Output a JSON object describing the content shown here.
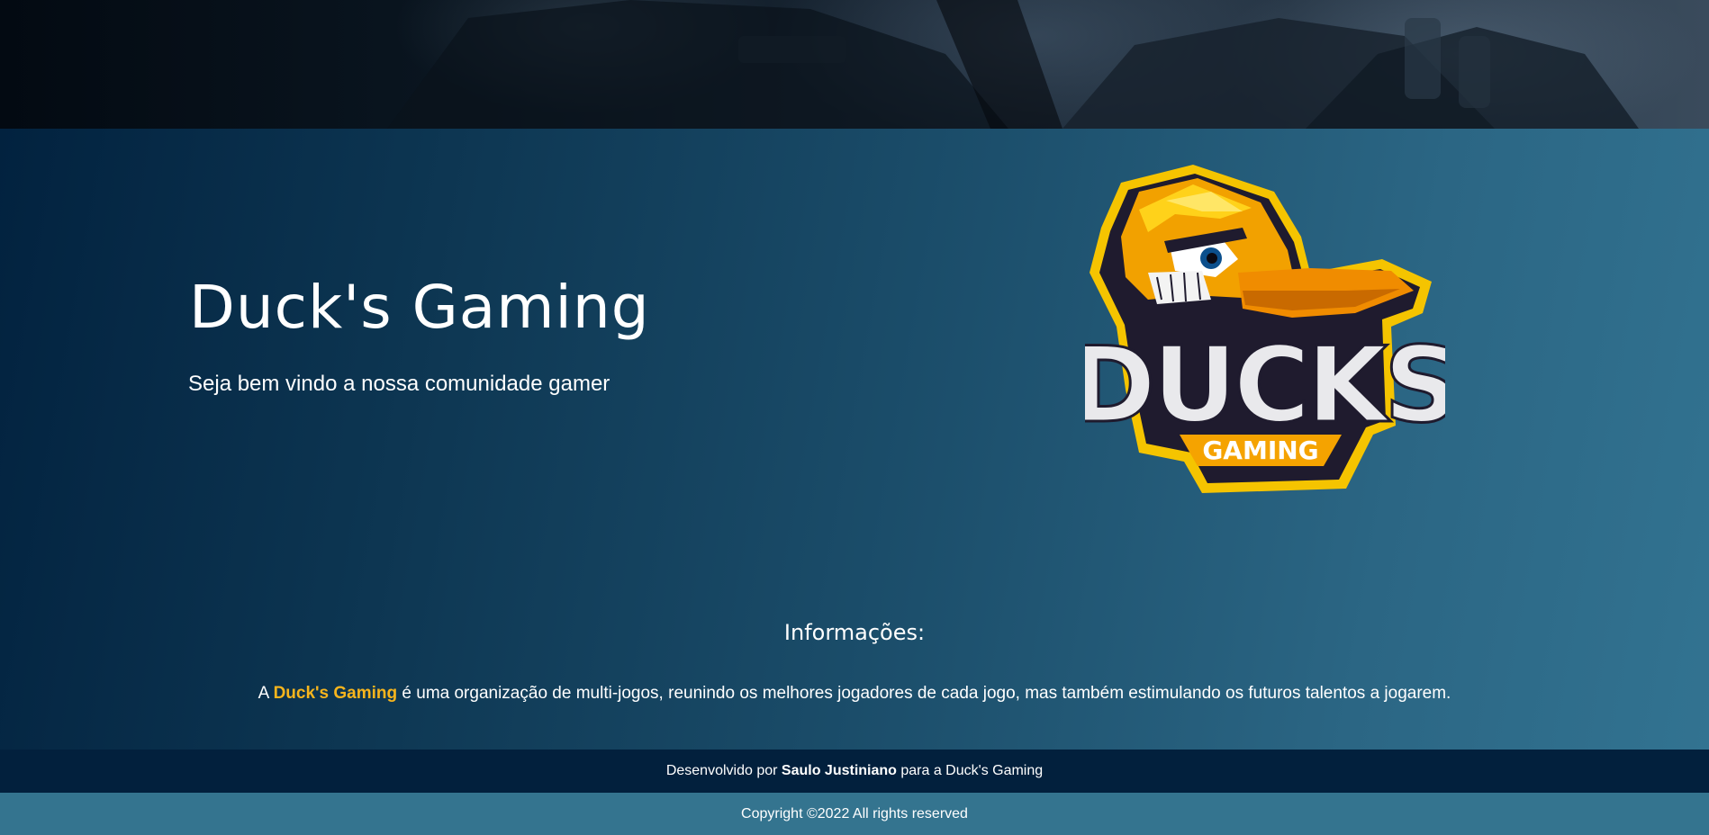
{
  "hero": {
    "title": "Duck's Gaming",
    "subtitle": "Seja bem vindo a nossa comunidade gamer"
  },
  "logo": {
    "wordmark": "DUCKS",
    "tagline": "GAMING"
  },
  "info": {
    "heading": "Informações:",
    "text_prefix": "A ",
    "brand": "Duck's Gaming",
    "text_suffix": " é uma organização de multi-jogos, reunindo os melhores jogadores de cada jogo, mas também estimulando os futuros talentos a jogarem."
  },
  "footer": {
    "dev_prefix": "Desenvolvido por ",
    "dev_name": "Saulo Justiniano",
    "dev_suffix": " para a Duck's Gaming",
    "copyright": "Copyright ©2022 All rights reserved"
  },
  "colors": {
    "brand_accent": "#f7b51d",
    "footer_dark": "#02203d",
    "footer_light": "#34748f"
  }
}
